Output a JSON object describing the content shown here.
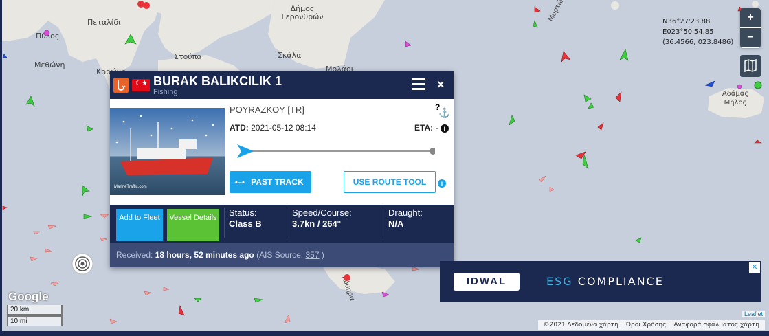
{
  "map": {
    "places": [
      {
        "label": "Πεταλίδι"
      },
      {
        "label": "Πύλος"
      },
      {
        "label": "Μεθώνη"
      },
      {
        "label": "Κορώνη"
      },
      {
        "label": "Στούπα"
      },
      {
        "label": "Σκάλα"
      },
      {
        "label": "Δήμος Γερονθρών"
      },
      {
        "label": "Μολάοι"
      },
      {
        "label": "Μυρτώο Πέλαγος"
      },
      {
        "label": "Αδάμας Μήλος"
      },
      {
        "label": "Κύθηρα"
      }
    ],
    "coords": {
      "lat": "N36°27'23.88",
      "lon": "E023°50'54.85",
      "decimal": "(36.4566, 023.8486)"
    },
    "zoom_in": "+",
    "zoom_out": "−",
    "google": "Google",
    "scale_km": "20 km",
    "scale_mi": "10 mi",
    "leaflet": "Leaflet",
    "attribution": [
      "©2021 Δεδομένα χάρτη",
      "Όροι Χρήσης",
      "Αναφορά σφάλματος χάρτη"
    ]
  },
  "popup": {
    "vessel_name": "BURAK BALIKCILIK 1",
    "vessel_type": "Fishing",
    "flag": "TR",
    "destination": "POYRAZKOY [TR]",
    "atd_label": "ATD:",
    "atd_value": "2021-05-12 08:14",
    "eta_label": "ETA:",
    "eta_value": "-",
    "past_track": "PAST TRACK",
    "route_tool": "USE ROUTE TOOL",
    "add_to_fleet": "Add to Fleet",
    "vessel_details": "Vessel Details",
    "status_label": "Status:",
    "status_value": "Class B",
    "speed_label": "Speed/Course:",
    "speed_value": "3.7kn / 264°",
    "draught_label": "Draught:",
    "draught_value": "N/A",
    "received_label": "Received:",
    "received_value": "18 hours, 52 minutes ago",
    "ais_source_label": "(AIS Source:",
    "ais_source_value": "357",
    "ais_source_close": ")",
    "photo_credit": "MarineTraffic.com"
  },
  "ad": {
    "brand": "IDWAL",
    "text_accent": "ESG",
    "text_rest": "COMPLIANCE",
    "close": "✕"
  },
  "colors": {
    "navy": "#1b2850",
    "blue_button": "#1aa3e8",
    "green_button": "#5bc236",
    "map_bg": "#c7cfdd"
  }
}
